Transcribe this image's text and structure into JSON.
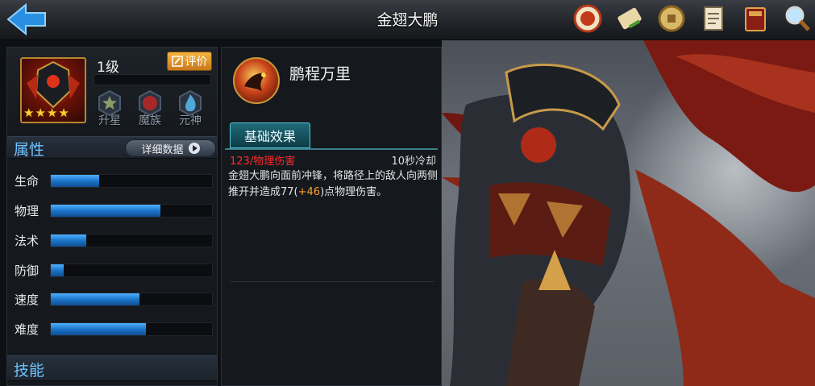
{
  "header": {
    "title": "金翅大鹏"
  },
  "top_icons": [
    "seal-icon",
    "scroll-icon",
    "coin-icon",
    "document-icon",
    "book-icon",
    "search-icon"
  ],
  "hero": {
    "level": "1级",
    "rate_label": "评价",
    "stars": 4,
    "badges": [
      {
        "label": "升星",
        "icon": "star-badge-icon"
      },
      {
        "label": "魔族",
        "icon": "demon-race-icon"
      },
      {
        "label": "元神",
        "icon": "spirit-flame-icon"
      }
    ]
  },
  "attributes": {
    "title": "属性",
    "detail_label": "详细数据",
    "stats": [
      {
        "label": "生命",
        "value": 0.3
      },
      {
        "label": "物理",
        "value": 0.68
      },
      {
        "label": "法术",
        "value": 0.22
      },
      {
        "label": "防御",
        "value": 0.08
      },
      {
        "label": "速度",
        "value": 0.55
      },
      {
        "label": "难度",
        "value": 0.59
      }
    ]
  },
  "skills_section": {
    "title": "技能"
  },
  "skill": {
    "name": "鹏程万里",
    "tab_label": "基础效果",
    "damage_text": "123/物理伤害",
    "cooldown_text": "10秒冷却",
    "desc_pre": "金翅大鹏向面前冲锋，将路径上的敌人向两侧推开并造成77(",
    "desc_bonus": "+46",
    "desc_post": ")点物理伤害。"
  },
  "colors": {
    "accent_blue": "#6fc3ff",
    "damage_red": "#ff2a2a",
    "bonus_orange": "#ff9f2a",
    "rate_orange": "#e89a2c",
    "bar_blue": "#1b75c9"
  }
}
